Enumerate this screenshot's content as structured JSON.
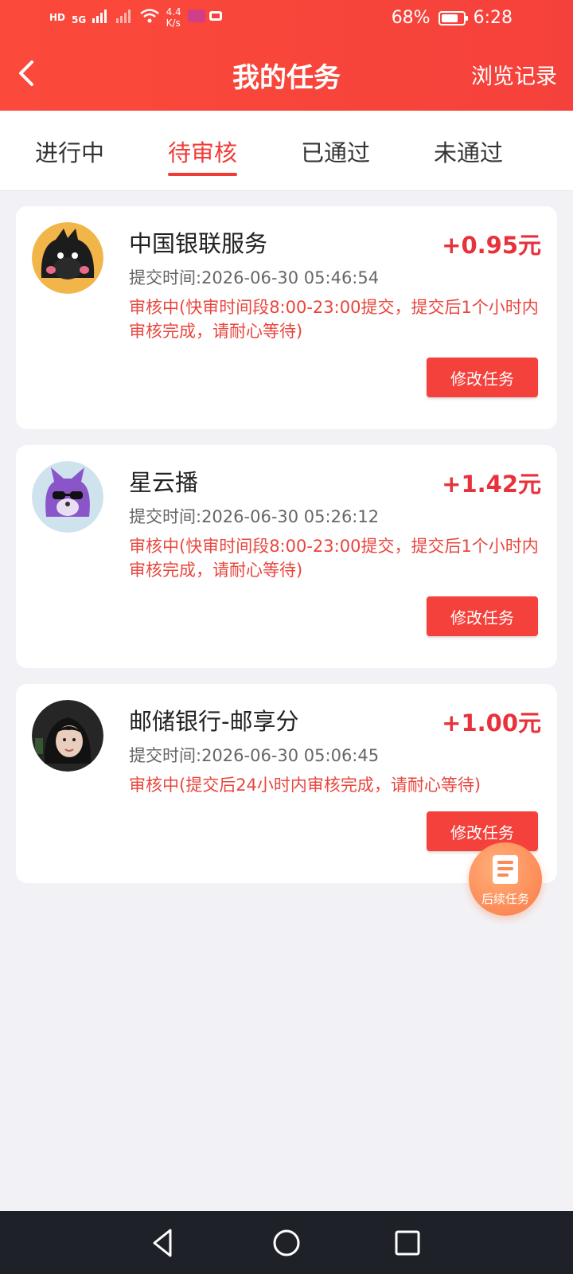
{
  "status_bar": {
    "hd": "HD",
    "network": "5G",
    "net_speed_top": "4.4",
    "net_speed_bottom": "K/s",
    "battery": "68%",
    "time": "6:28"
  },
  "header": {
    "title": "我的任务",
    "history_label": "浏览记录"
  },
  "tabs": [
    {
      "label": "进行中"
    },
    {
      "label": "待审核"
    },
    {
      "label": "已通过"
    },
    {
      "label": "未通过"
    }
  ],
  "active_tab": "待审核",
  "tasks": [
    {
      "name": "中国银联服务",
      "reward": "+0.95元",
      "submit_time": "提交时间:2026-06-30 05:46:54",
      "status_note": "审核中(快审时间段8:00-23:00提交，提交后1个小时内审核完成，请耐心等待)",
      "button": "修改任务"
    },
    {
      "name": "星云播",
      "reward": "+1.42元",
      "submit_time": "提交时间:2026-06-30 05:26:12",
      "status_note": "审核中(快审时间段8:00-23:00提交，提交后1个小时内审核完成，请耐心等待)",
      "button": "修改任务"
    },
    {
      "name": "邮储银行-邮享分",
      "reward": "+1.00元",
      "submit_time": "提交时间:2026-06-30 05:06:45",
      "status_note": "审核中(提交后24小时内审核完成，请耐心等待)",
      "button": "修改任务"
    }
  ],
  "fab": {
    "label": "后续任务",
    "icon": "document-list-icon"
  },
  "colors": {
    "accent": "#f5413b",
    "reward": "#e8313a",
    "note": "#e8463d"
  }
}
